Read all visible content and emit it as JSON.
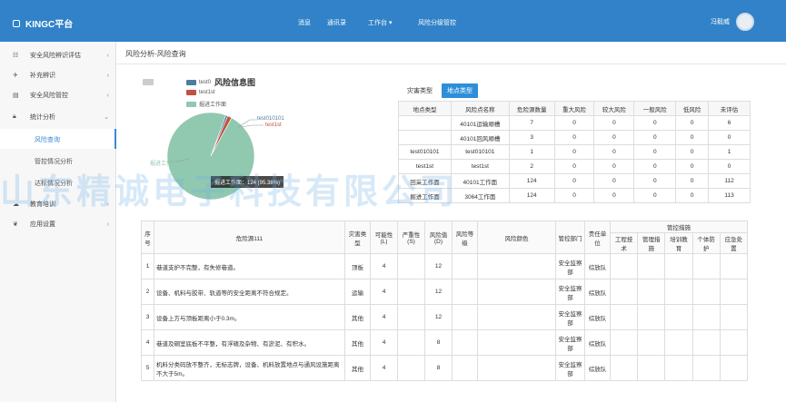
{
  "header": {
    "app_title": "KINGC平台",
    "nav": [
      "消息",
      "通讯录",
      "工作台 ▾",
      "风险分级管控"
    ],
    "user_name": "冯毅威"
  },
  "sidebar": {
    "items": [
      {
        "label": "安全风险辨识评估",
        "icon": "grid-icon",
        "arrow": "‹"
      },
      {
        "label": "补充辨识",
        "icon": "plane-icon",
        "arrow": "‹"
      },
      {
        "label": "安全风险管控",
        "icon": "book-icon",
        "arrow": "‹"
      },
      {
        "label": "统计分析",
        "icon": "lock-icon",
        "arrow": "⌄"
      },
      {
        "label": "教育培训",
        "icon": "cloud-icon",
        "arrow": "‹"
      },
      {
        "label": "应用设置",
        "icon": "leaf-icon",
        "arrow": "‹"
      }
    ],
    "subitems": [
      {
        "label": "风险查询"
      },
      {
        "label": "管控情况分析"
      },
      {
        "label": "达标情况分析"
      }
    ]
  },
  "breadcrumb": "风险分析-风险查询",
  "chart_data": {
    "type": "pie",
    "title": "风险信息图",
    "legend": [
      "test0",
      "test1st",
      "掘进工作面"
    ],
    "slices": [
      {
        "name": "test010101",
        "value": 1,
        "color": "#4d7d9e"
      },
      {
        "name": "test1st",
        "value": 2,
        "color": "#c0533f"
      },
      {
        "name": "掘进工作面",
        "value": 124,
        "color": "#91c8b0"
      }
    ],
    "slice_labels": [
      "test010101",
      "test1st",
      "掘进工作面"
    ],
    "tooltip": "掘进工作面：124 (95.38%)"
  },
  "tabs": [
    "灾害类型",
    "地点类型"
  ],
  "risk_table": {
    "headers": [
      "地点类型",
      "风险点名称",
      "危险源数量",
      "重大风险",
      "较大风险",
      "一般风险",
      "低风险",
      "未评估"
    ],
    "rows": [
      [
        "",
        "40101运输顺槽",
        "7",
        "0",
        "0",
        "0",
        "0",
        "6"
      ],
      [
        "",
        "40101回风顺槽",
        "3",
        "0",
        "0",
        "0",
        "0",
        "0"
      ],
      [
        "test010101",
        "test010101",
        "1",
        "0",
        "0",
        "0",
        "0",
        "1"
      ],
      [
        "test1st",
        "test1st",
        "2",
        "0",
        "0",
        "0",
        "0",
        "0"
      ],
      [
        "回采工作面",
        "40101工作面",
        "124",
        "0",
        "0",
        "0",
        "0",
        "112"
      ],
      [
        "掘进工作面",
        "3064工作面",
        "124",
        "0",
        "0",
        "0",
        "0",
        "113"
      ]
    ]
  },
  "hazard_table": {
    "headers": [
      "序号",
      "危险源111",
      "灾害类型",
      "可能性(L)",
      "严重性(S)",
      "风险值(D)",
      "风险等级",
      "风险颜色",
      "管控部门",
      "责任单位"
    ],
    "group_header": "管控措施",
    "sub_headers": [
      "工程技术",
      "管理措施",
      "培训教育",
      "个体防护",
      "应急处置"
    ],
    "rows": [
      {
        "no": "1",
        "desc": "巷道支护不完整，有失修巷道。",
        "type": "顶板",
        "l": "4",
        "s": "",
        "d": "12",
        "dept": "安全监察部",
        "unit": "综放队"
      },
      {
        "no": "2",
        "desc": "设备、机料与胶带、轨道等的安全距离不符合规定。",
        "type": "运输",
        "l": "4",
        "s": "",
        "d": "12",
        "dept": "安全监察部",
        "unit": "综放队"
      },
      {
        "no": "3",
        "desc": "设备上方与顶板距离小于0.3m。",
        "type": "其他",
        "l": "4",
        "s": "",
        "d": "12",
        "dept": "安全监察部",
        "unit": "综放队"
      },
      {
        "no": "4",
        "desc": "巷道及硐室底板不平整，有浮碴及杂物、有淤泥、有积水。",
        "type": "其他",
        "l": "4",
        "s": "",
        "d": "8",
        "dept": "安全监察部",
        "unit": "综放队"
      },
      {
        "no": "5",
        "desc": "机料分类码放不整齐，无标志牌，设备、机料放置地点与通风设施距离不大于5m。",
        "type": "其他",
        "l": "4",
        "s": "",
        "d": "8",
        "dept": "安全监察部",
        "unit": "综放队"
      }
    ]
  },
  "watermark": "山东精诚电子科技有限公司"
}
